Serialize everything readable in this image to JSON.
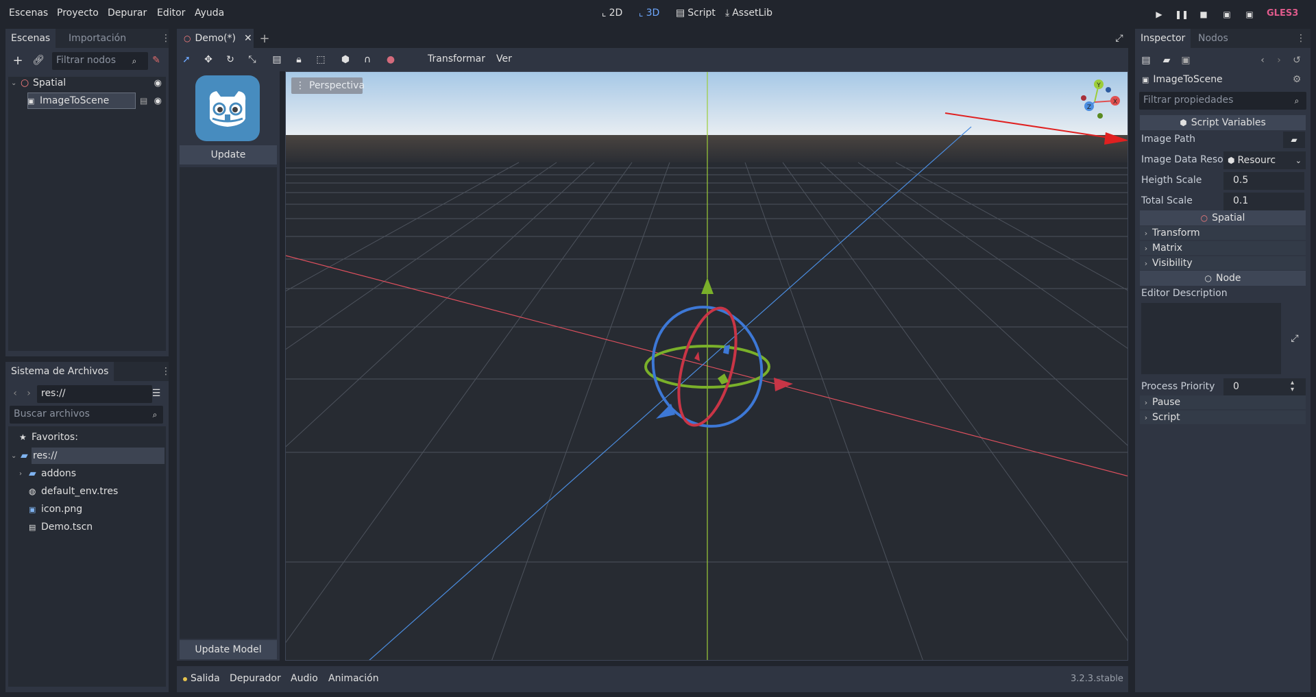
{
  "menu": [
    "Escenas",
    "Proyecto",
    "Depurar",
    "Editor",
    "Ayuda"
  ],
  "modes": [
    {
      "label": "2D",
      "icon": "2d-icon"
    },
    {
      "label": "3D",
      "icon": "3d-icon"
    },
    {
      "label": "Script",
      "icon": "script-icon"
    },
    {
      "label": "AssetLib",
      "icon": "assetlib-icon"
    }
  ],
  "renderer": "GLES3",
  "scene_dock": {
    "tabs": [
      "Escenas",
      "Importación"
    ],
    "filter_placeholder": "Filtrar nodos",
    "nodes": [
      {
        "label": "Spatial"
      },
      {
        "label": "ImageToScene"
      }
    ]
  },
  "filesystem": {
    "title": "Sistema de Archivos",
    "path": "res://",
    "search_placeholder": "Buscar archivos",
    "favorites": "Favoritos:",
    "root": "res://",
    "items": [
      {
        "label": "addons",
        "icon": "folder-icon"
      },
      {
        "label": "default_env.tres",
        "icon": "environment-icon"
      },
      {
        "label": "icon.png",
        "icon": "image-icon"
      },
      {
        "label": "Demo.tscn",
        "icon": "scene-icon"
      }
    ]
  },
  "editor_tabs": {
    "active": "Demo(*)"
  },
  "plugin_panel": {
    "update_label": "Update",
    "update_model_label": "Update Model"
  },
  "viewport_toolbar": {
    "transform": "Transformar",
    "view": "Ver"
  },
  "viewport": {
    "perspective": "Perspectiva"
  },
  "gizmo_axes": {
    "x": "X",
    "y": "Y",
    "z": "Z"
  },
  "bottom_panel": {
    "tabs": [
      "Salida",
      "Depurador",
      "Audio",
      "Animación"
    ],
    "version": "3.2.3.stable"
  },
  "inspector": {
    "tabs": [
      "Inspector",
      "Nodos"
    ],
    "node_name": "ImageToScene",
    "filter_placeholder": "Filtrar propiedades",
    "script_variables": "Script Variables",
    "image_path_label": "Image Path",
    "image_data_label": "Image Data Reso",
    "image_data_value": "Resourc",
    "height_scale_label": "Heigth Scale",
    "height_scale_value": "0.5",
    "total_scale_label": "Total Scale",
    "total_scale_value": "0.1",
    "spatial_section": "Spatial",
    "spatial_groups": [
      "Transform",
      "Matrix",
      "Visibility"
    ],
    "node_section": "Node",
    "editor_description_label": "Editor Description",
    "process_priority_label": "Process Priority",
    "process_priority_value": "0",
    "node_groups": [
      "Pause",
      "Script"
    ]
  }
}
